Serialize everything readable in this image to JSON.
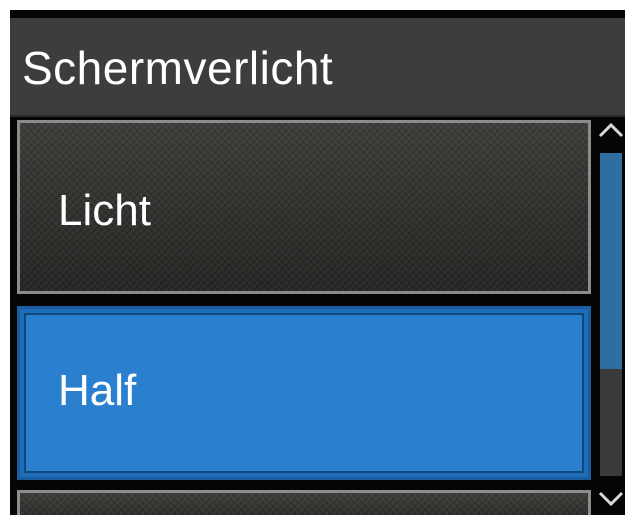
{
  "header": {
    "title": "Schermverlicht"
  },
  "menu": {
    "items": [
      {
        "label": "Licht",
        "selected": false
      },
      {
        "label": "Half",
        "selected": true
      },
      {
        "label": "",
        "selected": false
      }
    ]
  },
  "scrollbar": {
    "thumb_fraction": 0.67,
    "position_fraction": 0.0,
    "up_icon": "chevron-up-icon",
    "down_icon": "chevron-down-icon"
  },
  "colors": {
    "selected": "#2a7fcf",
    "title_bar": "#3d3d40",
    "scroll_thumb": "#2f6f9f"
  }
}
